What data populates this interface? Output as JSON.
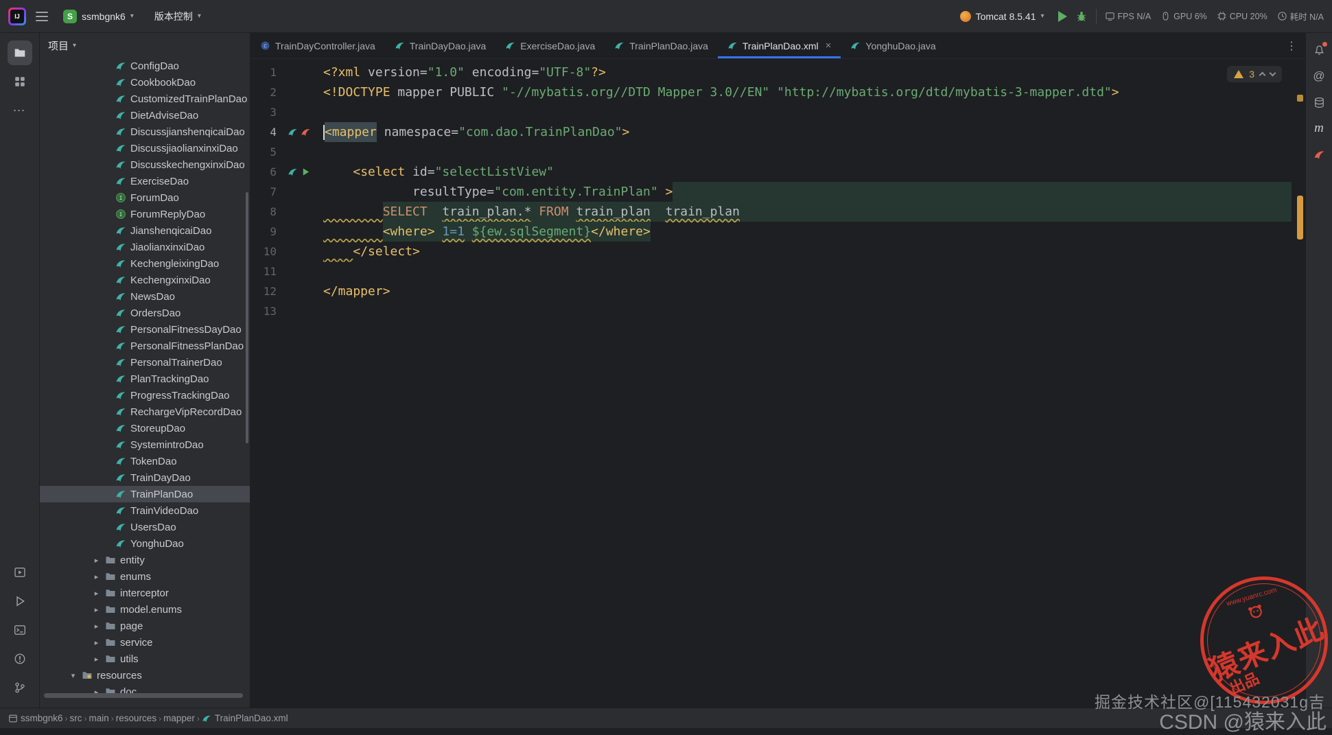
{
  "colors": {
    "accent": "#3574f0",
    "warning_stripe": "#d79b3f",
    "stamp_red": "#e0392d",
    "run_green": "#5fad65",
    "mybatis_teal": "#3fb1a8"
  },
  "toolbar": {
    "project_name": "ssmbgnk6",
    "project_initial": "S",
    "vcs_label": "版本控制",
    "run_config_label": "Tomcat 8.5.41",
    "metrics": [
      {
        "icon": "fps-icon",
        "text": "FPS N/A"
      },
      {
        "icon": "gpu-icon",
        "text": "GPU 6%"
      },
      {
        "icon": "cpu-icon",
        "text": "CPU 20%"
      },
      {
        "icon": "time-icon",
        "text": "耗时 N/A"
      }
    ]
  },
  "project_panel": {
    "title": "项目",
    "items": [
      {
        "label": "ConfigDao",
        "icon": "mybatis",
        "indent": 3
      },
      {
        "label": "CookbookDao",
        "icon": "mybatis",
        "indent": 3
      },
      {
        "label": "CustomizedTrainPlanDao",
        "icon": "mybatis",
        "indent": 3
      },
      {
        "label": "DietAdviseDao",
        "icon": "mybatis",
        "indent": 3
      },
      {
        "label": "DiscussjianshenqicaiDao",
        "icon": "mybatis",
        "indent": 3
      },
      {
        "label": "DiscussjiaolianxinxiDao",
        "icon": "mybatis",
        "indent": 3
      },
      {
        "label": "DiscusskechengxinxiDao",
        "icon": "mybatis",
        "indent": 3
      },
      {
        "label": "ExerciseDao",
        "icon": "mybatis",
        "indent": 3
      },
      {
        "label": "ForumDao",
        "icon": "interface",
        "indent": 3
      },
      {
        "label": "ForumReplyDao",
        "icon": "interface",
        "indent": 3
      },
      {
        "label": "JianshenqicaiDao",
        "icon": "mybatis",
        "indent": 3
      },
      {
        "label": "JiaolianxinxiDao",
        "icon": "mybatis",
        "indent": 3
      },
      {
        "label": "KechengleixingDao",
        "icon": "mybatis",
        "indent": 3
      },
      {
        "label": "KechengxinxiDao",
        "icon": "mybatis",
        "indent": 3
      },
      {
        "label": "NewsDao",
        "icon": "mybatis",
        "indent": 3
      },
      {
        "label": "OrdersDao",
        "icon": "mybatis",
        "indent": 3
      },
      {
        "label": "PersonalFitnessDayDao",
        "icon": "mybatis",
        "indent": 3
      },
      {
        "label": "PersonalFitnessPlanDao",
        "icon": "mybatis",
        "indent": 3
      },
      {
        "label": "PersonalTrainerDao",
        "icon": "mybatis",
        "indent": 3
      },
      {
        "label": "PlanTrackingDao",
        "icon": "mybatis",
        "indent": 3
      },
      {
        "label": "ProgressTrackingDao",
        "icon": "mybatis",
        "indent": 3
      },
      {
        "label": "RechargeVipRecordDao",
        "icon": "mybatis",
        "indent": 3
      },
      {
        "label": "StoreupDao",
        "icon": "mybatis",
        "indent": 3
      },
      {
        "label": "SystemintroDao",
        "icon": "mybatis",
        "indent": 3
      },
      {
        "label": "TokenDao",
        "icon": "mybatis",
        "indent": 3
      },
      {
        "label": "TrainDayDao",
        "icon": "mybatis",
        "indent": 3
      },
      {
        "label": "TrainPlanDao",
        "icon": "mybatis",
        "indent": 3,
        "selected": true
      },
      {
        "label": "TrainVideoDao",
        "icon": "mybatis",
        "indent": 3
      },
      {
        "label": "UsersDao",
        "icon": "mybatis",
        "indent": 3
      },
      {
        "label": "YonghuDao",
        "icon": "mybatis",
        "indent": 3
      },
      {
        "label": "entity",
        "icon": "folder",
        "indent": 2,
        "chevron": "right"
      },
      {
        "label": "enums",
        "icon": "folder",
        "indent": 2,
        "chevron": "right"
      },
      {
        "label": "interceptor",
        "icon": "folder",
        "indent": 2,
        "chevron": "right"
      },
      {
        "label": "model.enums",
        "icon": "folder",
        "indent": 2,
        "chevron": "right"
      },
      {
        "label": "page",
        "icon": "folder",
        "indent": 2,
        "chevron": "right"
      },
      {
        "label": "service",
        "icon": "folder",
        "indent": 2,
        "chevron": "right"
      },
      {
        "label": "utils",
        "icon": "folder",
        "indent": 2,
        "chevron": "right"
      },
      {
        "label": "resources",
        "icon": "folder-res",
        "indent": 1,
        "chevron": "down"
      },
      {
        "label": "doc",
        "icon": "folder",
        "indent": 2,
        "chevron": "right"
      }
    ]
  },
  "tabs": [
    {
      "label": "TrainDayController.java",
      "icon": "class"
    },
    {
      "label": "TrainDayDao.java",
      "icon": "mybatis"
    },
    {
      "label": "ExerciseDao.java",
      "icon": "mybatis"
    },
    {
      "label": "TrainPlanDao.java",
      "icon": "mybatis"
    },
    {
      "label": "TrainPlanDao.xml",
      "icon": "mybatis",
      "active": true,
      "closable": true
    },
    {
      "label": "YonghuDao.java",
      "icon": "mybatis"
    }
  ],
  "editor": {
    "inspection": {
      "warning_count": "3"
    },
    "lines": [
      {
        "n": 1,
        "tokens": [
          {
            "t": "<?xml ",
            "c": "tag"
          },
          {
            "t": "version",
            "c": "attr"
          },
          {
            "t": "=",
            "c": "pl"
          },
          {
            "t": "\"1.0\"",
            "c": "str"
          },
          {
            "t": " ",
            "c": "pl"
          },
          {
            "t": "encoding",
            "c": "attr"
          },
          {
            "t": "=",
            "c": "pl"
          },
          {
            "t": "\"UTF-8\"",
            "c": "str"
          },
          {
            "t": "?>",
            "c": "tag"
          }
        ]
      },
      {
        "n": 2,
        "tokens": [
          {
            "t": "<!DOCTYPE",
            "c": "tag"
          },
          {
            "t": " mapper PUBLIC ",
            "c": "pl"
          },
          {
            "t": "\"-//mybatis.org//DTD Mapper 3.0//EN\"",
            "c": "str"
          },
          {
            "t": " ",
            "c": "pl"
          },
          {
            "t": "\"http://mybatis.org/dtd/mybatis-3-mapper.dtd\"",
            "c": "str"
          },
          {
            "t": ">",
            "c": "tag"
          }
        ]
      },
      {
        "n": 3,
        "tokens": []
      },
      {
        "n": 4,
        "caret": true,
        "gutter": [
          "bird",
          "bird-red"
        ],
        "tokens": [
          {
            "t": "<mapper",
            "c": "tag hl"
          },
          {
            "t": " ",
            "c": "pl"
          },
          {
            "t": "namespace",
            "c": "attr"
          },
          {
            "t": "=",
            "c": "pl"
          },
          {
            "t": "\"com.dao.TrainPlanDao\"",
            "c": "str"
          },
          {
            "t": ">",
            "c": "tag"
          }
        ]
      },
      {
        "n": 5,
        "tokens": []
      },
      {
        "n": 6,
        "gutter": [
          "bird",
          "play"
        ],
        "tokens": [
          {
            "t": "    ",
            "c": "pl"
          },
          {
            "t": "<select",
            "c": "tag"
          },
          {
            "t": " ",
            "c": "pl"
          },
          {
            "t": "id",
            "c": "attr"
          },
          {
            "t": "=",
            "c": "pl"
          },
          {
            "t": "\"selectListView\"",
            "c": "str"
          }
        ]
      },
      {
        "n": 7,
        "fill": "inj",
        "tokens": [
          {
            "t": "            ",
            "c": "pl"
          },
          {
            "t": "resultType",
            "c": "attr"
          },
          {
            "t": "=",
            "c": "pl"
          },
          {
            "t": "\"com.entity.TrainPlan\"",
            "c": "str"
          },
          {
            "t": " ",
            "c": "pl"
          },
          {
            "t": ">",
            "c": "tag"
          }
        ]
      },
      {
        "n": 8,
        "fill": "inj",
        "tokens": [
          {
            "t": "        ",
            "c": "pl wavy"
          },
          {
            "t": "SELECT",
            "c": "kw inj"
          },
          {
            "t": "  ",
            "c": "pl inj"
          },
          {
            "t": "train_plan.*",
            "c": "pl inj wavy"
          },
          {
            "t": " ",
            "c": "pl inj"
          },
          {
            "t": "FROM",
            "c": "kw inj"
          },
          {
            "t": " ",
            "c": "pl inj"
          },
          {
            "t": "train_plan",
            "c": "pl inj wavy"
          },
          {
            "t": "  ",
            "c": "pl inj"
          },
          {
            "t": "train_plan",
            "c": "pl inj wavy"
          }
        ]
      },
      {
        "n": 9,
        "tokens": [
          {
            "t": "        ",
            "c": "pl wavy"
          },
          {
            "t": "<where>",
            "c": "tag inj"
          },
          {
            "t": " ",
            "c": "pl inj"
          },
          {
            "t": "1=1",
            "c": "num inj wavy"
          },
          {
            "t": " ",
            "c": "pl inj"
          },
          {
            "t": "${ew.sqlSegment}",
            "c": "var inj wavy"
          },
          {
            "t": "</where>",
            "c": "tag inj"
          }
        ]
      },
      {
        "n": 10,
        "tokens": [
          {
            "t": "    ",
            "c": "pl wavy"
          },
          {
            "t": "</select>",
            "c": "tag"
          }
        ]
      },
      {
        "n": 11,
        "tokens": []
      },
      {
        "n": 12,
        "tokens": [
          {
            "t": "</mapper>",
            "c": "tag"
          }
        ]
      },
      {
        "n": 13,
        "tokens": []
      }
    ]
  },
  "status_bar": {
    "crumbs": [
      "ssmbgnk6",
      "src",
      "main",
      "resources",
      "mapper",
      "TrainPlanDao.xml"
    ]
  },
  "watermarks": {
    "stamp_main": "猿来入此",
    "stamp_sub": "出品",
    "stamp_site": "www.yuanrc.com",
    "line1": "掘金技术社区@[115432031g吉",
    "line2": "CSDN @猿来入此"
  }
}
